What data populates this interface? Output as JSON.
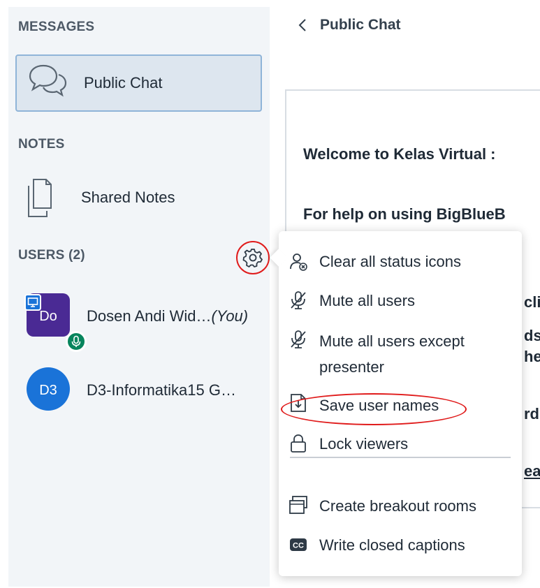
{
  "sidebar": {
    "messages_title": "MESSAGES",
    "public_chat_label": "Public Chat",
    "notes_title": "NOTES",
    "shared_notes_label": "Shared Notes",
    "users_title": "USERS (2)",
    "users": [
      {
        "initials": "Do",
        "name": "Dosen Andi Wid…",
        "tag": "(You)",
        "avatar_color": "#4a2a94",
        "presenter": true,
        "mic": true
      },
      {
        "initials": "D3",
        "name": "D3-Informatika15 G…",
        "tag": "",
        "avatar_color": "#1a73d8",
        "presenter": false,
        "mic": false
      }
    ]
  },
  "main": {
    "back_title": "Public Chat",
    "welcome_prefix": "Welcome to ",
    "welcome_bold": "Kelas Virtual :",
    "help_line": "For help on using BigBlueB",
    "fragments": [
      "cli",
      "ds",
      "he",
      "rd",
      "ear"
    ]
  },
  "menu": {
    "items": [
      {
        "label": "Clear all status icons",
        "icon": "clear-status-icon"
      },
      {
        "label": "Mute all users",
        "icon": "mic-muted-icon"
      },
      {
        "label": "Mute all users except",
        "label2": "presenter",
        "icon": "mic-muted-icon"
      },
      {
        "label": "Save user names",
        "icon": "download-file-icon"
      },
      {
        "label": "Lock viewers",
        "icon": "lock-icon"
      },
      {
        "label": "Create breakout rooms",
        "icon": "rooms-icon"
      },
      {
        "label": "Write closed captions",
        "icon": "cc-icon"
      }
    ]
  },
  "colors": {
    "annotation_red": "#e01b1b",
    "presenter_avatar": "#4a2a94",
    "viewer_avatar": "#1a73d8",
    "mic_green": "#07855d"
  }
}
